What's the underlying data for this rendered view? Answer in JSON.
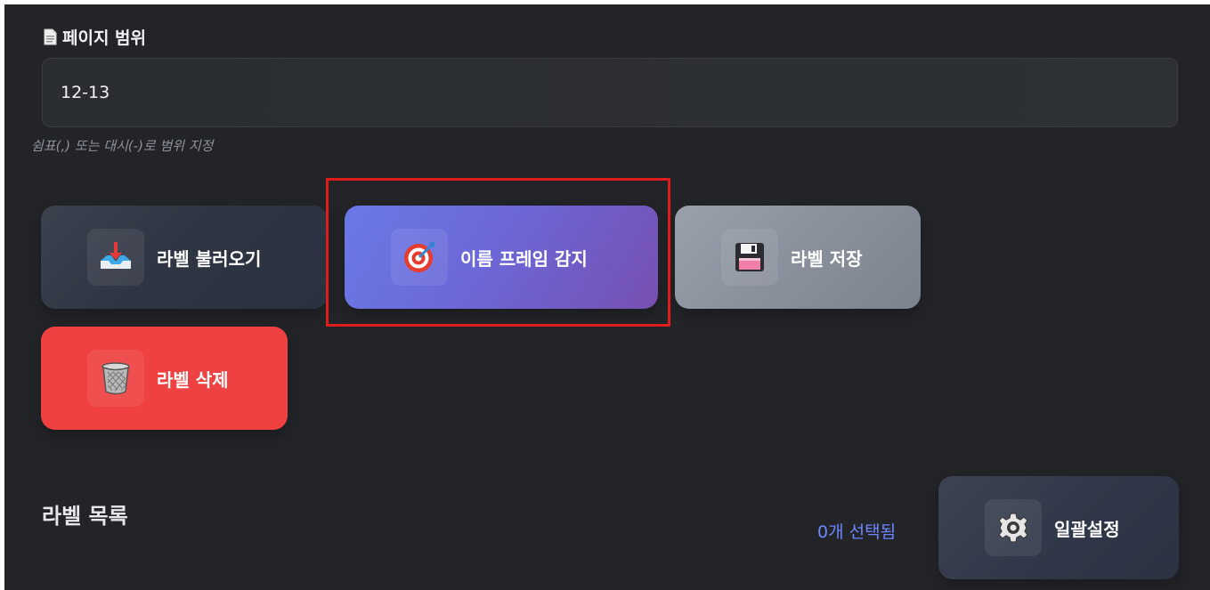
{
  "page_range": {
    "title": "페이지 범위",
    "icon": "document-icon",
    "value": "12-13",
    "hint": "쉼표(,) 또는 대시(-)로 범위 지정"
  },
  "actions": {
    "load": {
      "label": "라벨 불러오기",
      "icon": "inbox-tray-icon"
    },
    "detect": {
      "label": "이름 프레임 감지",
      "icon": "target-icon"
    },
    "save": {
      "label": "라벨 저장",
      "icon": "floppy-disk-icon"
    },
    "delete": {
      "label": "라벨 삭제",
      "icon": "trash-can-icon"
    }
  },
  "label_list": {
    "title": "라벨 목록",
    "selected_text": "0개 선택됨",
    "batch": {
      "label": "일괄설정",
      "icon": "gear-icon"
    }
  },
  "colors": {
    "panel_bg": "#222428",
    "accent_blue": "#6f86ff",
    "danger": "#ef4141",
    "highlight": "#e01b1b"
  }
}
